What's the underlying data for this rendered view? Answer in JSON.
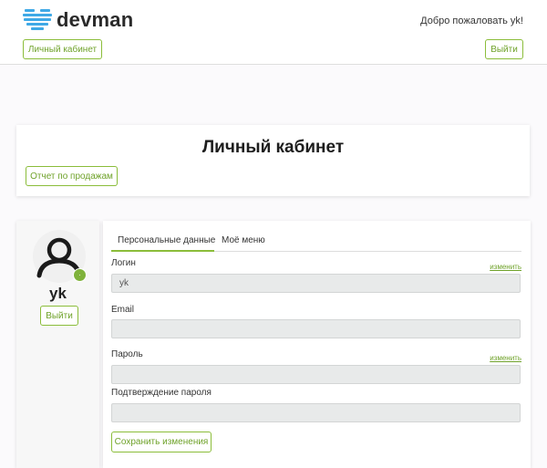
{
  "header": {
    "brand": "devman",
    "welcome": "Добро пожаловать yk!",
    "cabinet_button": "Личный кабинет",
    "logout_button": "Выйти"
  },
  "page": {
    "title": "Личный кабинет",
    "sales_report_button": "Отчет по продажам"
  },
  "profile": {
    "username": "yk",
    "logout_button": "Выйти",
    "status_dot": "·"
  },
  "tabs": [
    {
      "label": "Персональные данные",
      "active": true
    },
    {
      "label": "Моё меню",
      "active": false
    }
  ],
  "form": {
    "login_label": "Логин",
    "login_value": "yk",
    "login_change": "изменить",
    "email_label": "Email",
    "email_value": "",
    "password_label": "Пароль",
    "password_change": "изменить",
    "password_value": "",
    "confirm_label": "Подтверждение пароля",
    "confirm_value": "",
    "save_button": "Сохранить изменения"
  },
  "colors": {
    "accent": "#8bbd3a",
    "logo": "#3fa9e6"
  },
  "icons": [
    "heart-logo-icon",
    "user-avatar-icon",
    "status-dot-icon",
    "text-cursor-icon"
  ]
}
